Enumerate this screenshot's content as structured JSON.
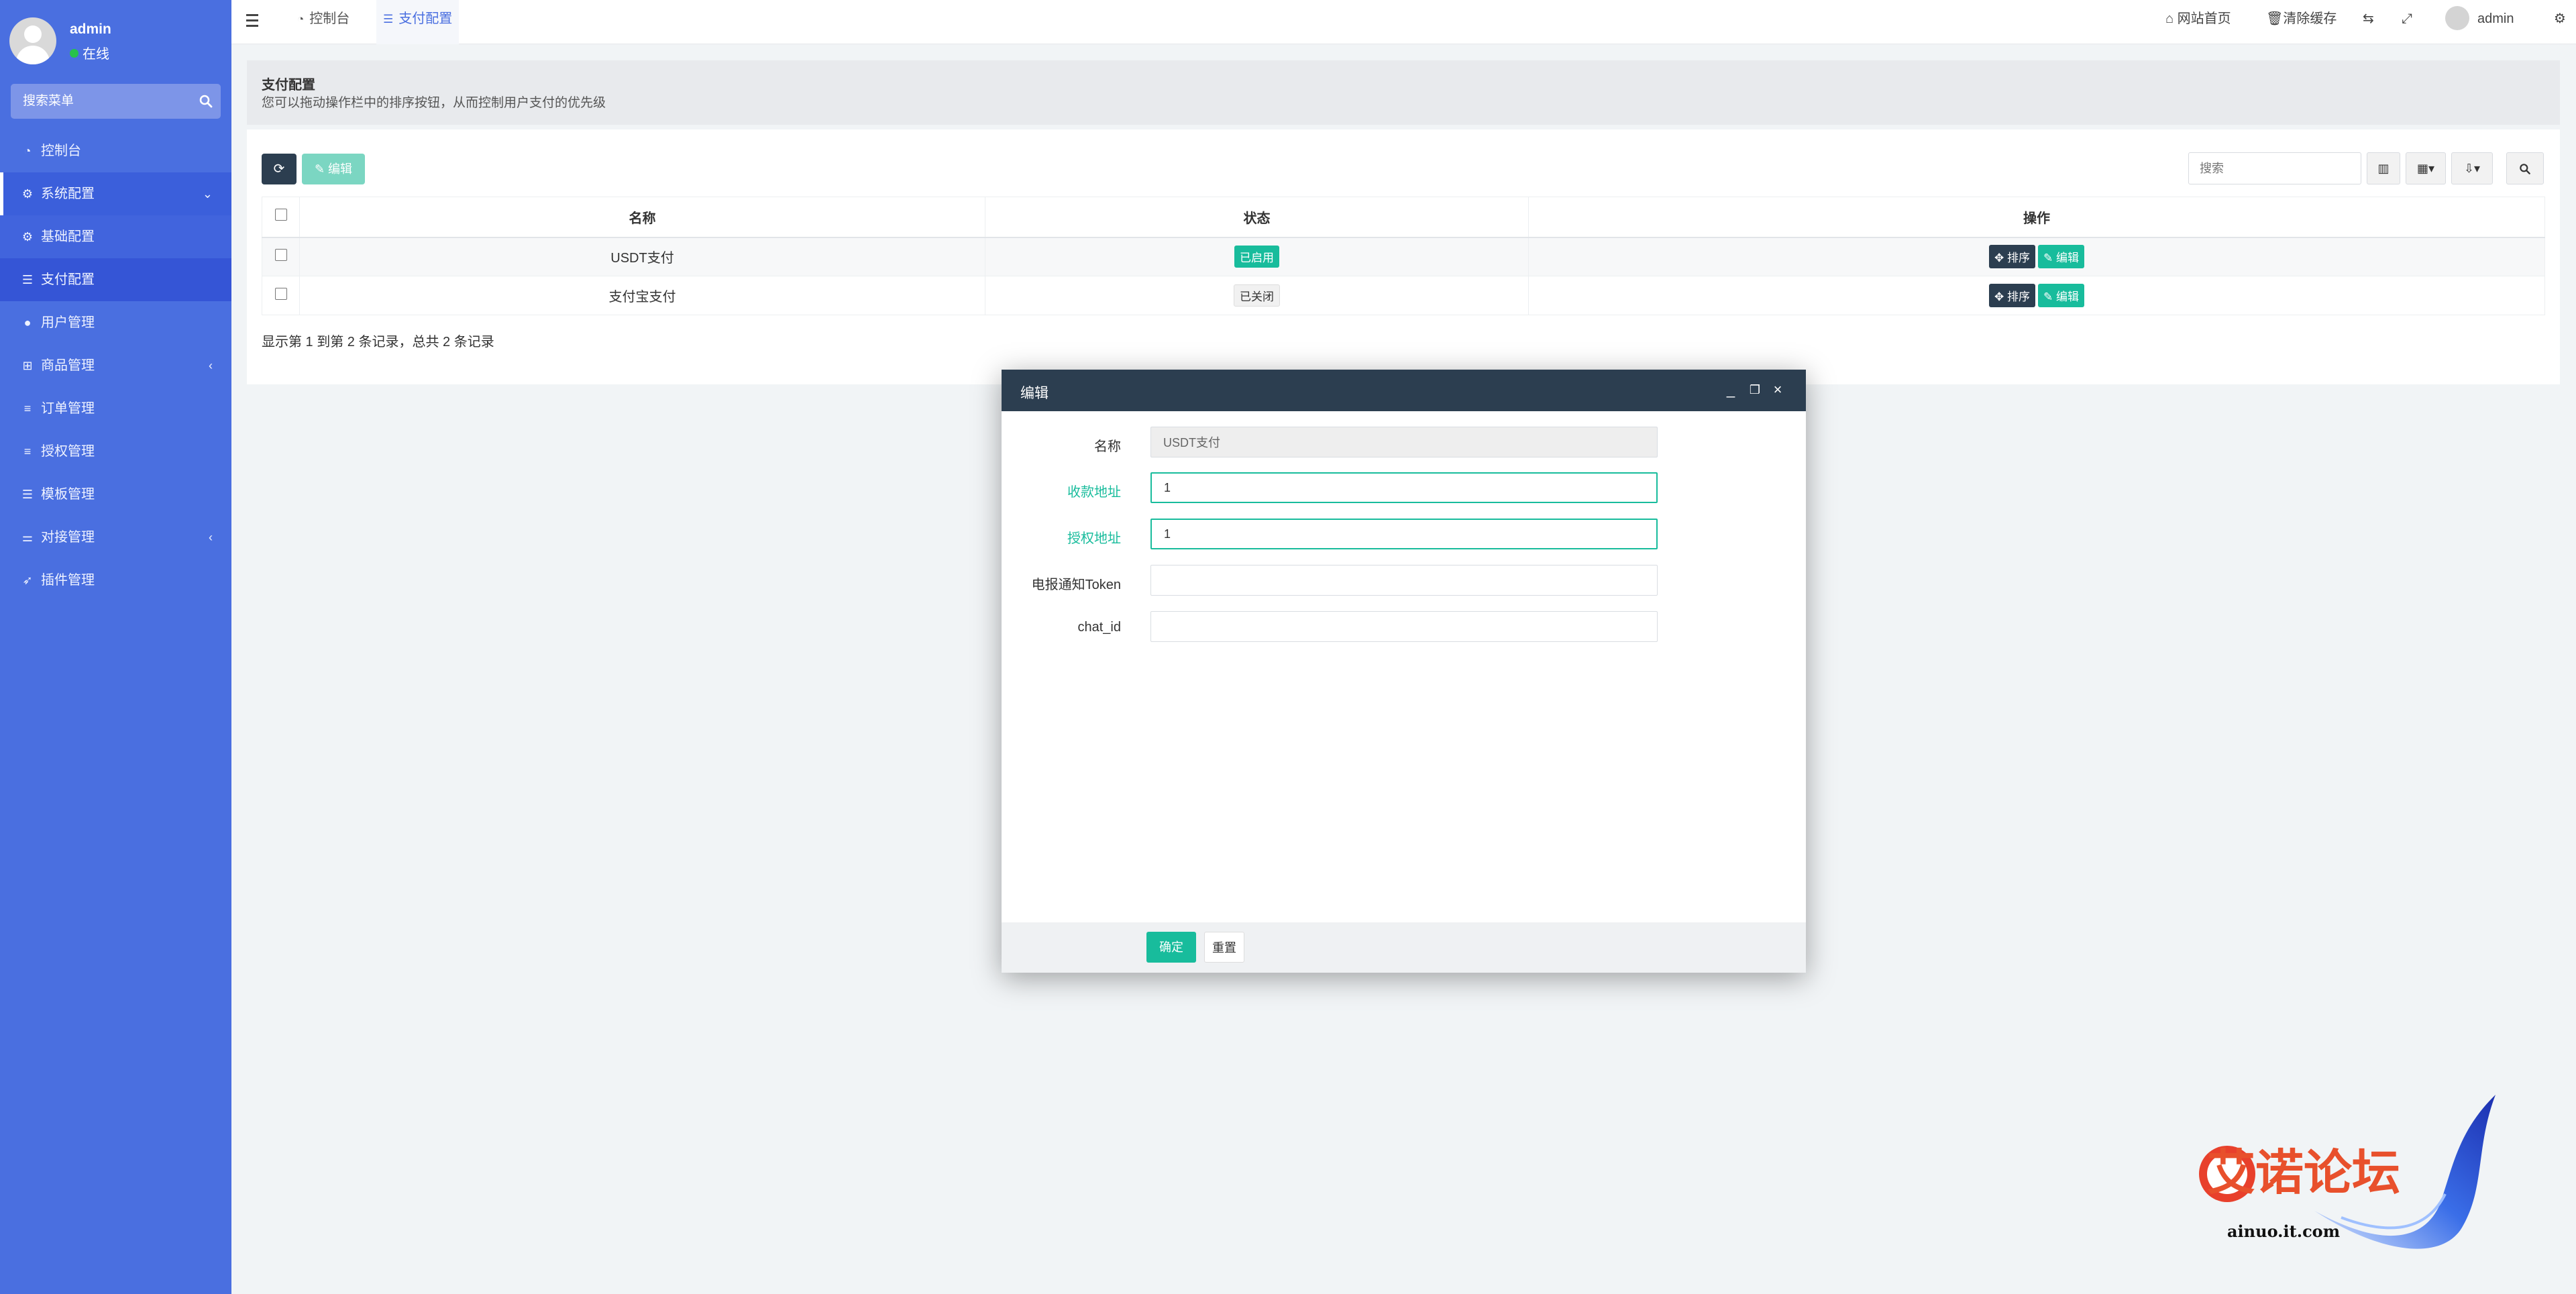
{
  "sidebar": {
    "user": {
      "name": "admin",
      "status": "在线"
    },
    "search_placeholder": "搜索菜单",
    "items": [
      {
        "label": "控制台",
        "icon": "dashboard-icon"
      },
      {
        "label": "系统配置",
        "icon": "gear-icon"
      },
      {
        "label": "基础配置",
        "icon": "gear-icon"
      },
      {
        "label": "支付配置",
        "icon": "table-icon"
      },
      {
        "label": "用户管理",
        "icon": "user-icon"
      },
      {
        "label": "商品管理",
        "icon": "cart-icon"
      },
      {
        "label": "订单管理",
        "icon": "list-icon"
      },
      {
        "label": "授权管理",
        "icon": "list-icon"
      },
      {
        "label": "模板管理",
        "icon": "table-icon"
      },
      {
        "label": "对接管理",
        "icon": "sliders-icon"
      },
      {
        "label": "插件管理",
        "icon": "rocket-icon"
      }
    ]
  },
  "header": {
    "tabs": [
      {
        "label": "控制台"
      },
      {
        "label": "支付配置"
      }
    ],
    "links": {
      "home": "网站首页",
      "clear_cache": "清除缓存",
      "user": "admin"
    }
  },
  "page": {
    "title": "支付配置",
    "description": "您可以拖动操作栏中的排序按钮，从而控制用户支付的优先级"
  },
  "toolbar": {
    "edit_label": "编辑",
    "search_placeholder": "搜索"
  },
  "table": {
    "headers": [
      "名称",
      "状态",
      "操作"
    ],
    "rows": [
      {
        "name": "USDT支付",
        "status": "已启用",
        "status_on": true
      },
      {
        "name": "支付宝支付",
        "status": "已关闭",
        "status_on": false
      }
    ],
    "sort_label": "排序",
    "edit_label": "编辑",
    "pagination": "显示第 1 到第 2 条记录，总共 2 条记录"
  },
  "modal": {
    "title": "编辑",
    "fields": [
      {
        "label": "名称",
        "value": "USDT支付"
      },
      {
        "label": "收款地址",
        "value": "1"
      },
      {
        "label": "授权地址",
        "value": "1"
      },
      {
        "label": "电报通知Token",
        "value": ""
      },
      {
        "label": "chat_id",
        "value": ""
      }
    ],
    "ok_label": "确定",
    "reset_label": "重置"
  },
  "watermark": {
    "title": "艾诺论坛",
    "url": "ainuo.it.com"
  },
  "colors": {
    "sidebar": "#4a6fe0",
    "accent": "#18bc9c",
    "dark": "#2c3e50"
  }
}
